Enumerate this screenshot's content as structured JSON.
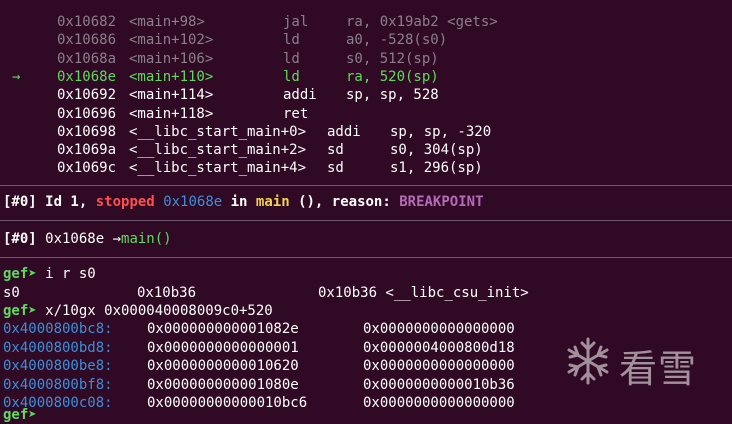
{
  "disasm": [
    {
      "arrow": "",
      "addr": "0x10682",
      "sym": "<main+98>",
      "op": "jal",
      "args": "ra, 0x19ab2 <gets>",
      "state": "past"
    },
    {
      "arrow": "",
      "addr": "0x10686",
      "sym": "<main+102>",
      "op": "ld",
      "args": "a0, -528(s0)",
      "state": "past"
    },
    {
      "arrow": "",
      "addr": "0x1068a",
      "sym": "<main+106>",
      "op": "ld",
      "args": "s0, 512(sp)",
      "state": "past"
    },
    {
      "arrow": "→",
      "addr": "0x1068e",
      "sym": "<main+110>",
      "op": "ld",
      "args": "ra, 520(sp)",
      "state": "current"
    },
    {
      "arrow": "",
      "addr": "0x10692",
      "sym": "<main+114>",
      "op": "addi",
      "args": "sp, sp, 528",
      "state": "next"
    },
    {
      "arrow": "",
      "addr": "0x10696",
      "sym": "<main+118>",
      "op": "ret",
      "args": "",
      "state": "next"
    },
    {
      "arrow": "",
      "addr": "0x10698",
      "sym": "<__libc_start_main+0>",
      "op": "addi",
      "args": "sp, sp, -320",
      "state": "next"
    },
    {
      "arrow": "",
      "addr": "0x1069a",
      "sym": "<__libc_start_main+2>",
      "op": "sd",
      "args": "s0, 304(sp)",
      "state": "next"
    },
    {
      "arrow": "",
      "addr": "0x1069c",
      "sym": "<__libc_start_main+4>",
      "op": "sd",
      "args": "s1, 296(sp)",
      "state": "next"
    }
  ],
  "threads": {
    "prefix": "[#0]",
    "id_text": " Id 1, ",
    "status": "stopped",
    "addr": "0x1068e",
    "in_text": " in ",
    "func": "main",
    "args_text": " (), reason: ",
    "reason": "BREAKPOINT"
  },
  "trace": {
    "prefix": "[#0]",
    "addr": " 0x1068e ",
    "arrow": "→",
    "func": "main()"
  },
  "prompt": "gef➤",
  "cmd1": " i r s0",
  "reg_out": {
    "name": "s0",
    "hex": "0x10b36",
    "sym": "0x10b36 <__libc_csu_init>"
  },
  "cmd2": " x/10gx 0x000040008009c0+520",
  "mem": [
    {
      "addr": "0x4000800bc8:",
      "v1": "0x000000000001082e",
      "v2": "0x0000000000000000"
    },
    {
      "addr": "0x4000800bd8:",
      "v1": "0x0000000000000001",
      "v2": "0x0000004000800d18"
    },
    {
      "addr": "0x4000800be8:",
      "v1": "0x0000000000010620",
      "v2": "0x0000000000000000"
    },
    {
      "addr": "0x4000800bf8:",
      "v1": "0x000000000001080e",
      "v2": "0x0000000000010b36"
    },
    {
      "addr": "0x4000800c08:",
      "v1": "0x00000000000010bc6",
      "v2": "0x0000000000000000"
    }
  ],
  "watermark": {
    "text": "看雪",
    "icon": "snowflake-icon"
  },
  "colors": {
    "background": "#300a24",
    "green": "#5fd95f",
    "cyan": "#3b8fd9",
    "red": "#ff4f4f",
    "yellow": "#f0d24c",
    "purple": "#b56ab8"
  }
}
